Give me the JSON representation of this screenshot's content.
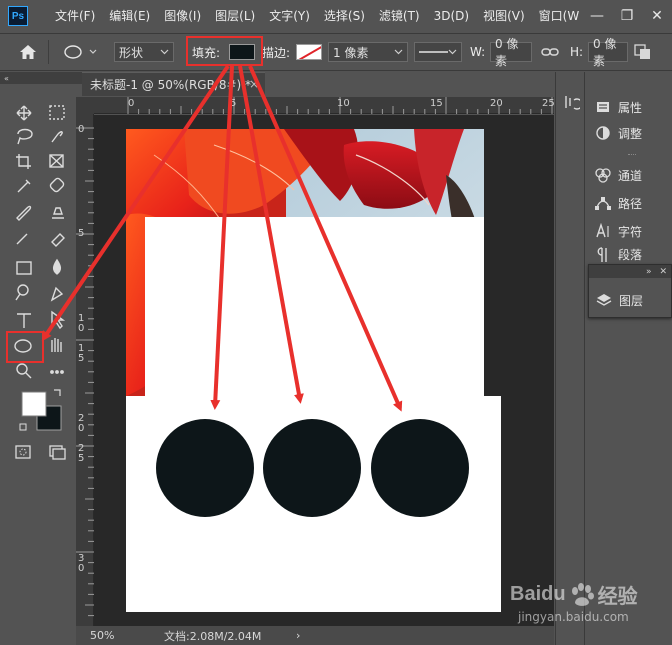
{
  "app": {
    "logo_text": "Ps"
  },
  "menu": {
    "items": [
      "文件(F)",
      "编辑(E)",
      "图像(I)",
      "图层(L)",
      "文字(Y)",
      "选择(S)",
      "滤镜(T)",
      "3D(D)",
      "视图(V)",
      "窗口(W"
    ]
  },
  "window_controls": {
    "minimize": "—",
    "restore": "❐",
    "close": "✕"
  },
  "options_bar": {
    "mode_value": "形状",
    "fill_label": "填充:",
    "fill_color": "#0d1619",
    "stroke_label": "描边:",
    "stroke_width": "1 像素",
    "width_label": "W:",
    "width_value": "0 像素",
    "height_label": "H:",
    "height_value": "0 像素"
  },
  "document": {
    "tab_title": "未标题-1 @ 50%(RGB/8#) *",
    "tab_close": "×",
    "ruler_top_labels": [
      "0",
      "5",
      "10",
      "15",
      "20",
      "25"
    ],
    "ruler_left_labels": [
      "0",
      "5",
      "1\n0",
      "1\n5",
      "2\n0",
      "2\n5",
      "3\n0"
    ],
    "circle_color": "#0d1619",
    "zoom": "50%",
    "doc_size": "文档:2.08M/2.04M",
    "status_arrow": "›"
  },
  "panels": {
    "items": [
      {
        "label": "属性",
        "icon": "properties-icon"
      },
      {
        "label": "调整",
        "icon": "adjustments-icon"
      },
      {
        "label": "通道",
        "icon": "channels-icon"
      },
      {
        "label": "路径",
        "icon": "paths-icon"
      },
      {
        "label": "字符",
        "icon": "character-icon"
      },
      {
        "label": "段落",
        "icon": "paragraph-icon"
      }
    ],
    "layers_label": "图层"
  },
  "watermark": {
    "brand": "Baidu",
    "suffix": "经验",
    "url": "jingyan.baidu.com"
  },
  "colors": {
    "highlight": "#e8302c",
    "arrow": "#e8302c"
  }
}
